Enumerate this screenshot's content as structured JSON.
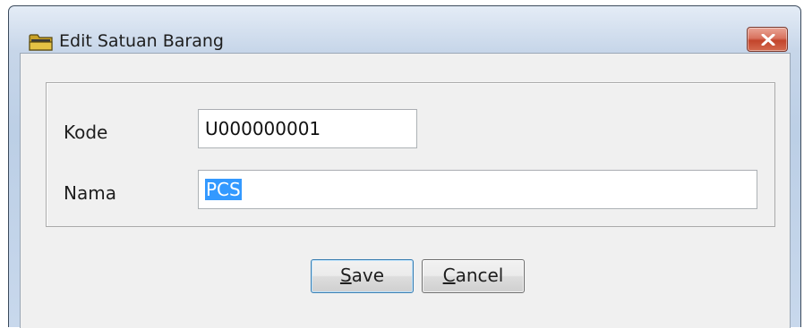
{
  "window": {
    "title": "Edit Satuan Barang",
    "icon": "folder-icon",
    "close_icon": "close-icon"
  },
  "form": {
    "kode_label": "Kode",
    "kode_value": "U000000001",
    "nama_label": "Nama",
    "nama_value": "PCS"
  },
  "buttons": {
    "save_mnemonic": "S",
    "save_rest": "ave",
    "cancel_mnemonic": "C",
    "cancel_rest": "ancel"
  },
  "colors": {
    "selection": "#3399ff",
    "close_button": "#c2452c"
  }
}
